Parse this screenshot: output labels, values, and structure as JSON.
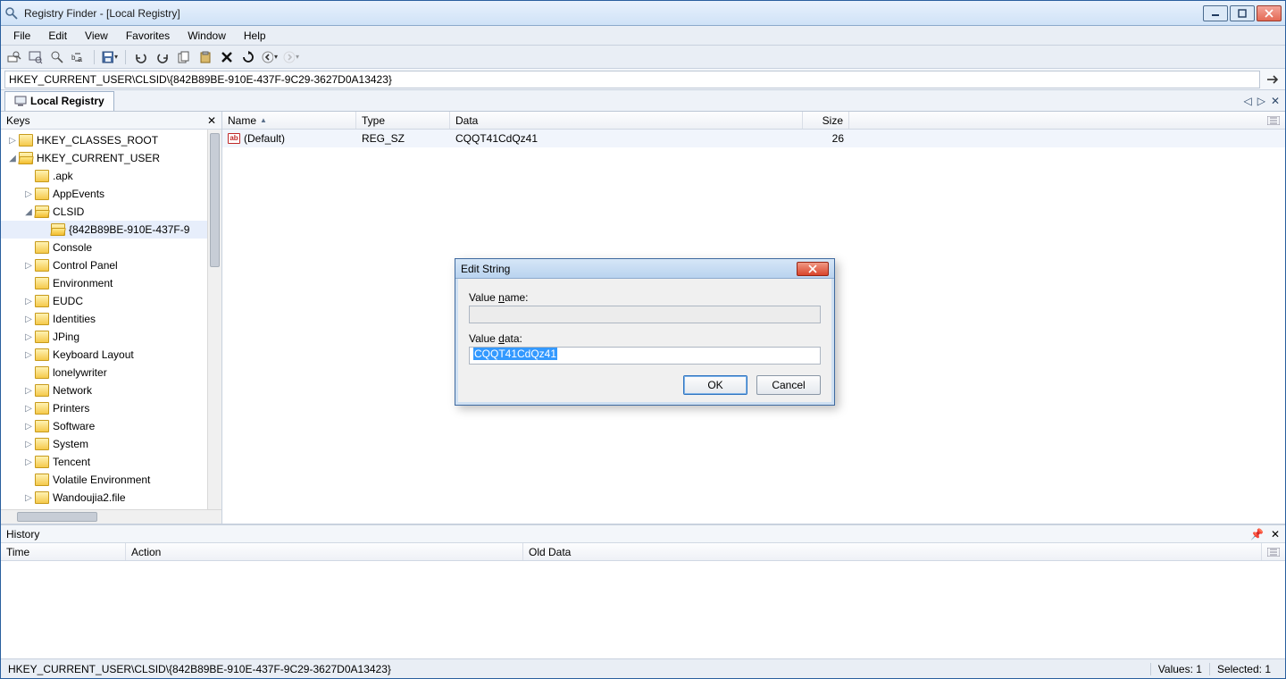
{
  "window": {
    "title": "Registry Finder - [Local Registry]"
  },
  "menu": {
    "file": "File",
    "edit": "Edit",
    "view": "View",
    "favorites": "Favorites",
    "window": "Window",
    "help": "Help"
  },
  "address": {
    "path": "HKEY_CURRENT_USER\\CLSID\\{842B89BE-910E-437F-9C29-3627D0A13423}"
  },
  "docTab": {
    "label": "Local Registry"
  },
  "keysPane": {
    "title": "Keys"
  },
  "tree": {
    "items": [
      {
        "ind": 0,
        "tw": "▷",
        "label": "HKEY_CLASSES_ROOT"
      },
      {
        "ind": 0,
        "tw": "◢",
        "label": "HKEY_CURRENT_USER",
        "open": true
      },
      {
        "ind": 1,
        "tw": "",
        "label": ".apk"
      },
      {
        "ind": 1,
        "tw": "▷",
        "label": "AppEvents"
      },
      {
        "ind": 1,
        "tw": "◢",
        "label": "CLSID",
        "open": true
      },
      {
        "ind": 2,
        "tw": "",
        "label": "{842B89BE-910E-437F-9",
        "sel": true,
        "open": true
      },
      {
        "ind": 1,
        "tw": "",
        "label": "Console"
      },
      {
        "ind": 1,
        "tw": "▷",
        "label": "Control Panel"
      },
      {
        "ind": 1,
        "tw": "",
        "label": "Environment"
      },
      {
        "ind": 1,
        "tw": "▷",
        "label": "EUDC"
      },
      {
        "ind": 1,
        "tw": "▷",
        "label": "Identities"
      },
      {
        "ind": 1,
        "tw": "▷",
        "label": "JPing"
      },
      {
        "ind": 1,
        "tw": "▷",
        "label": "Keyboard Layout"
      },
      {
        "ind": 1,
        "tw": "",
        "label": "lonelywriter"
      },
      {
        "ind": 1,
        "tw": "▷",
        "label": "Network"
      },
      {
        "ind": 1,
        "tw": "▷",
        "label": "Printers"
      },
      {
        "ind": 1,
        "tw": "▷",
        "label": "Software"
      },
      {
        "ind": 1,
        "tw": "▷",
        "label": "System"
      },
      {
        "ind": 1,
        "tw": "▷",
        "label": "Tencent"
      },
      {
        "ind": 1,
        "tw": "",
        "label": "Volatile Environment"
      },
      {
        "ind": 1,
        "tw": "▷",
        "label": "Wandoujia2.file"
      }
    ]
  },
  "valuesGrid": {
    "headers": {
      "name": "Name",
      "type": "Type",
      "data": "Data",
      "size": "Size"
    },
    "rows": [
      {
        "name": "(Default)",
        "type": "REG_SZ",
        "data": "CQQT41CdQz41",
        "size": "26"
      }
    ]
  },
  "history": {
    "title": "History",
    "headers": {
      "time": "Time",
      "action": "Action",
      "old": "Old Data"
    }
  },
  "status": {
    "path": "HKEY_CURRENT_USER\\CLSID\\{842B89BE-910E-437F-9C29-3627D0A13423}",
    "values": "Values: 1",
    "selected": "Selected: 1"
  },
  "dialog": {
    "title": "Edit String",
    "valueNamePrefix": "Value ",
    "valueNameLetter": "n",
    "valueNameSuffix": "ame:",
    "valueDataPrefix": "Value ",
    "valueDataLetter": "d",
    "valueDataSuffix": "ata:",
    "name": "",
    "data": "CQQT41CdQz41",
    "ok": "OK",
    "cancel": "Cancel"
  }
}
